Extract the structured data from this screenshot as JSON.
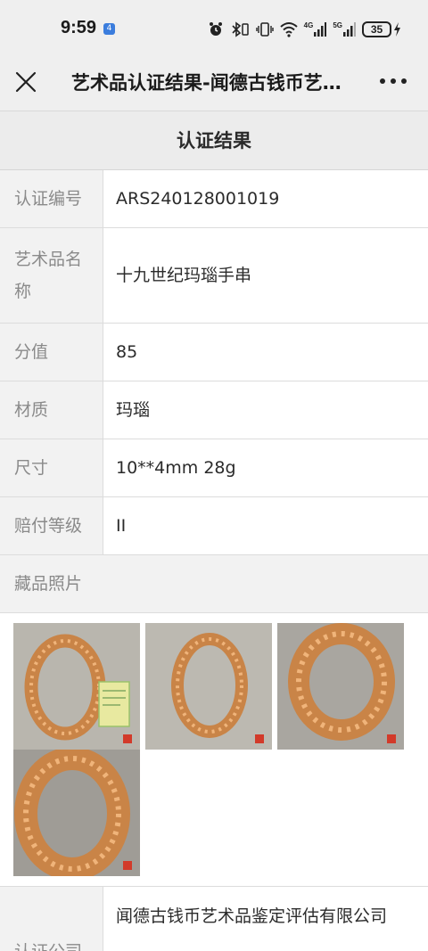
{
  "status_bar": {
    "time": "9:59",
    "app_badge": "4",
    "net_4g": "4G",
    "net_5g": "5G",
    "battery": "35"
  },
  "nav": {
    "title": "艺术品认证结果-闻德古钱币艺术品鉴定评估有限公司",
    "close_icon": "close-icon",
    "more_icon": "more-icon"
  },
  "result": {
    "header": "认证结果",
    "rows": [
      {
        "label": "认证编号",
        "value": "ARS240128001019"
      },
      {
        "label": "艺术品名称",
        "value": "十九世纪玛瑙手串"
      },
      {
        "label": "分值",
        "value": "85"
      },
      {
        "label": "材质",
        "value": "玛瑙"
      },
      {
        "label": "尺寸",
        "value": "10**4mm 28g"
      },
      {
        "label": "赔付等级",
        "value": "II"
      }
    ],
    "photos_title": "藏品照片",
    "photos": [
      "photo-1",
      "photo-2",
      "photo-3",
      "photo-4"
    ],
    "company_label": "认证公司",
    "company_value": "闻德古钱币艺术品鉴定评估有限公司"
  },
  "colors": {
    "bead": "#d08a4e",
    "bead_light": "#f0b47a",
    "photo_bg": "#b7b4ad",
    "seal": "#d23a2a"
  }
}
